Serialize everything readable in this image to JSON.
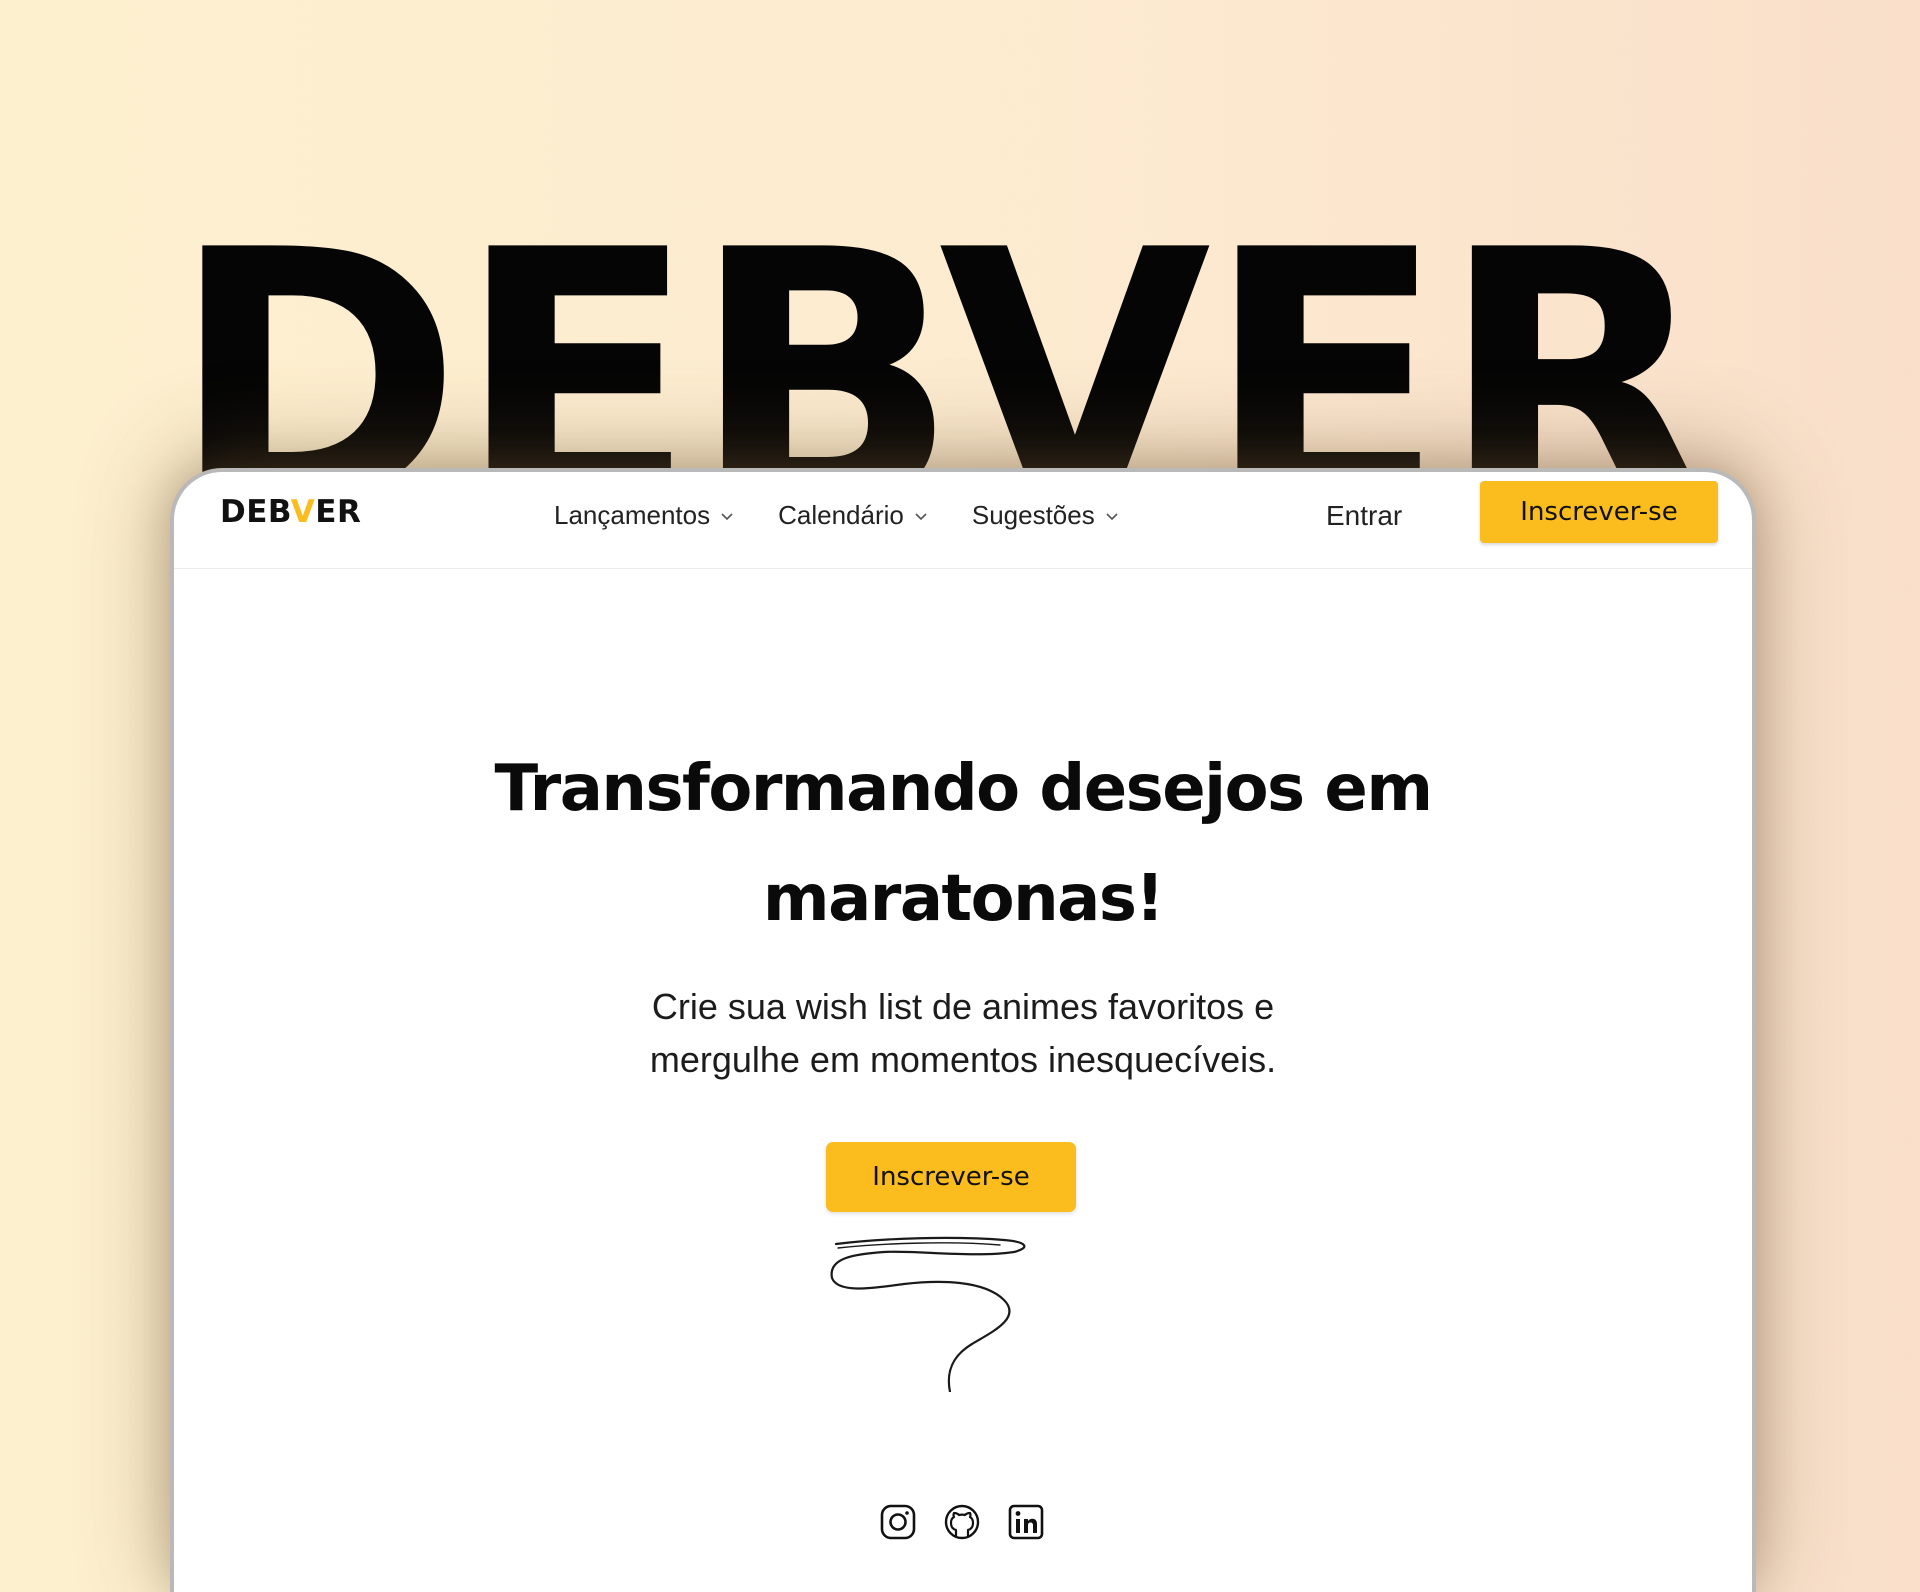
{
  "hero_word": "DEBVER",
  "navbar": {
    "logo": {
      "prefix": "DEB",
      "accent": "V",
      "suffix": "ER"
    },
    "links": [
      {
        "label": "Lançamentos",
        "icon": "chevron-down-icon"
      },
      {
        "label": "Calendário",
        "icon": "chevron-down-icon"
      },
      {
        "label": "Sugestões",
        "icon": "chevron-down-icon"
      }
    ],
    "signin_label": "Entrar",
    "signup_label": "Inscrever-se"
  },
  "hero": {
    "title_lines": [
      "Transformando desejos em",
      "maratonas!"
    ],
    "subtitle_lines": [
      "Crie sua wish list de animes favoritos e",
      "mergulhe em momentos inesquecíveis."
    ],
    "cta_label": "Inscrever-se"
  },
  "socials": [
    "instagram-icon",
    "github-icon",
    "linkedin-icon"
  ],
  "colors": {
    "accent": "#fbbd1d",
    "text": "#0a0a0a",
    "card": "#ffffff"
  }
}
